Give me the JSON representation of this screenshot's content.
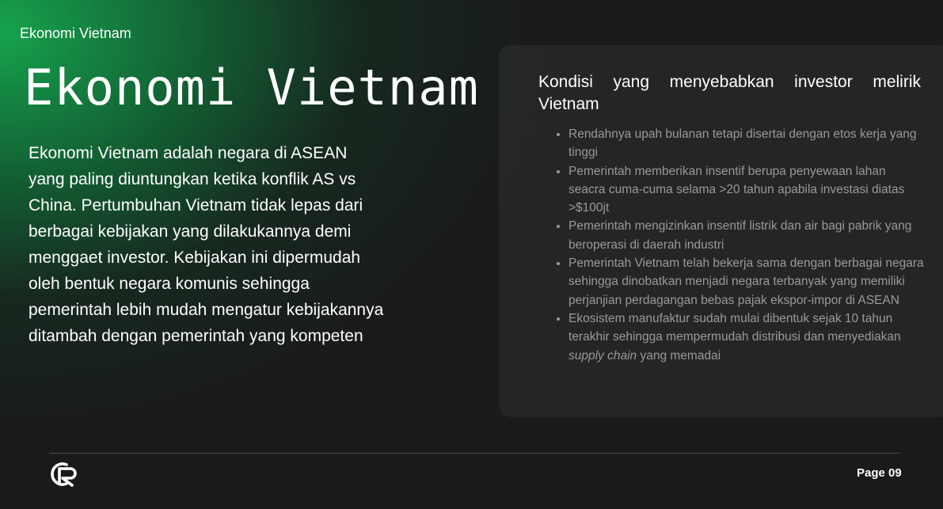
{
  "header": {
    "label": "Ekonomi Vietnam"
  },
  "title": "Ekonomi Vietnam",
  "intro": "Ekonomi Vietnam adalah negara di ASEAN yang paling diuntungkan ketika konflik AS vs China. Pertumbuhan Vietnam tidak lepas dari berbagai kebijakan yang dilakukannya demi menggaet investor. Kebijakan ini dipermudah oleh bentuk negara komunis sehingga pemerintah lebih mudah mengatur kebijakannya ditambah dengan pemerintah yang kompeten",
  "panel": {
    "heading": "Kondisi yang menyebabkan investor melirik Vietnam",
    "bullets": [
      "Rendahnya upah bulanan tetapi disertai dengan etos kerja yang tinggi",
      "Pemerintah memberikan insentif berupa penyewaan lahan seacra cuma-cuma selama >20 tahun apabila investasi diatas >$100jt",
      "Pemerintah mengizinkan insentif listrik dan air bagi pabrik yang beroperasi di daerah industri",
      "Pemerintah Vietnam telah bekerja sama dengan berbagai negara sehingga dinobatkan menjadi negara terbanyak yang memiliki perjanjian perdagangan bebas pajak ekspor-impor di ASEAN"
    ],
    "last_bullet": {
      "before": "Ekosistem manufaktur sudah mulai dibentuk sejak 10 tahun terakhir sehingga mempermudah distribusi dan menyediakan ",
      "italic": "supply chain",
      "after": " yang memadai"
    }
  },
  "footer": {
    "page": "Page 09",
    "logo_icon": "cr-logo-icon"
  },
  "colors": {
    "accent": "#16aa50",
    "background": "#1a1a1a",
    "panel": "#282828",
    "muted_text": "#9a9a9a"
  }
}
